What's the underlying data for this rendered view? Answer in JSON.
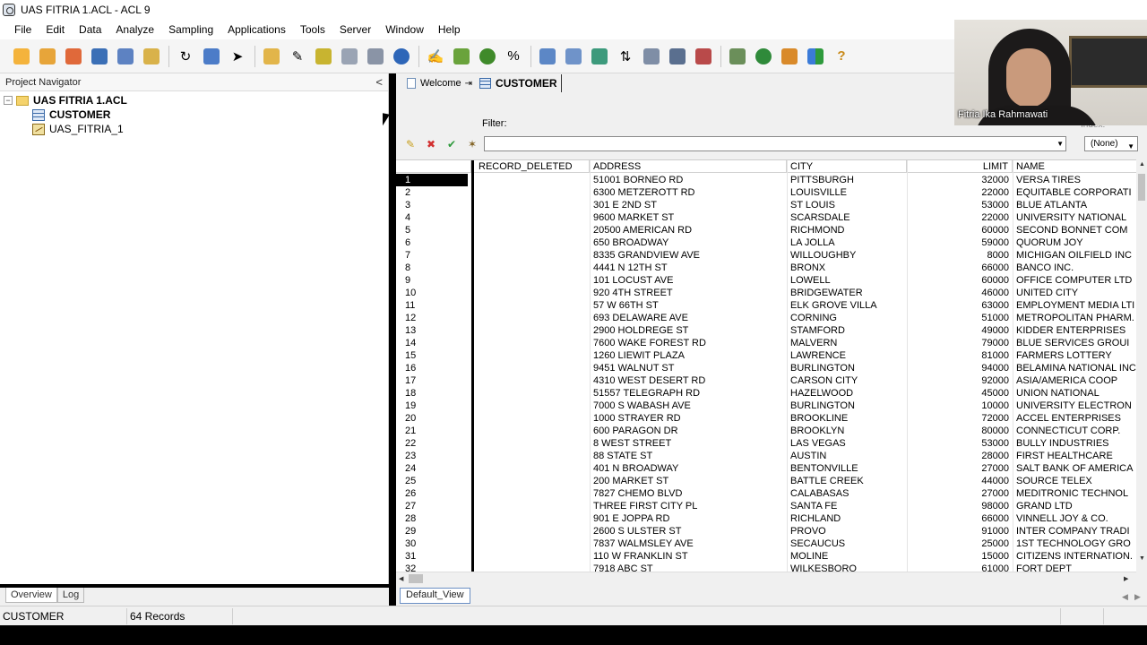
{
  "window": {
    "title": "UAS FITRIA 1.ACL - ACL 9"
  },
  "menu": [
    "File",
    "Edit",
    "Data",
    "Analyze",
    "Sampling",
    "Applications",
    "Tools",
    "Server",
    "Window",
    "Help"
  ],
  "navigator": {
    "title": "Project Navigator",
    "collapse_symbol": "<",
    "project": "UAS FITRIA 1.ACL",
    "items": [
      "CUSTOMER",
      "UAS_FITRIA_1"
    ],
    "tabs": [
      "Overview",
      "Log"
    ]
  },
  "doc_tabs": {
    "welcome": "Welcome",
    "customer": "CUSTOMER"
  },
  "filter": {
    "label": "Filter:",
    "value": "",
    "index_label": "Index:",
    "index_value": "(None)"
  },
  "table": {
    "columns": [
      "RECORD_DELETED",
      "ADDRESS",
      "CITY",
      "LIMIT",
      "NAME"
    ],
    "rows": [
      [
        "1",
        "",
        "51001 BORNEO RD",
        "PITTSBURGH",
        "32000",
        "VERSA TIRES"
      ],
      [
        "2",
        "",
        "6300 METZEROTT RD",
        "LOUISVILLE",
        "22000",
        "EQUITABLE CORPORATI"
      ],
      [
        "3",
        "",
        "301 E 2ND ST",
        "ST LOUIS",
        "53000",
        "BLUE ATLANTA"
      ],
      [
        "4",
        "",
        "9600 MARKET ST",
        "SCARSDALE",
        "22000",
        "UNIVERSITY NATIONAL"
      ],
      [
        "5",
        "",
        "20500 AMERICAN RD",
        "RICHMOND",
        "60000",
        "SECOND BONNET COM"
      ],
      [
        "6",
        "",
        "650 BROADWAY",
        "LA JOLLA",
        "59000",
        "QUORUM JOY"
      ],
      [
        "7",
        "",
        "8335 GRANDVIEW AVE",
        "WILLOUGHBY",
        "8000",
        "MICHIGAN OILFIELD INC"
      ],
      [
        "8",
        "",
        "4441 N 12TH ST",
        "BRONX",
        "66000",
        "BANCO INC."
      ],
      [
        "9",
        "",
        "101 LOCUST AVE",
        "LOWELL",
        "60000",
        "OFFICE COMPUTER LTD"
      ],
      [
        "10",
        "",
        "920 4TH STREET",
        "BRIDGEWATER",
        "46000",
        "UNITED CITY"
      ],
      [
        "11",
        "",
        "57 W 66TH ST",
        "ELK GROVE VILLA",
        "63000",
        "EMPLOYMENT MEDIA LTI"
      ],
      [
        "12",
        "",
        "693 DELAWARE AVE",
        "CORNING",
        "51000",
        "METROPOLITAN PHARM."
      ],
      [
        "13",
        "",
        "2900 HOLDREGE ST",
        "STAMFORD",
        "49000",
        "KIDDER ENTERPRISES"
      ],
      [
        "14",
        "",
        "7600 WAKE FOREST RD",
        "MALVERN",
        "79000",
        "BLUE SERVICES GROUI"
      ],
      [
        "15",
        "",
        "1260 LIEWIT PLAZA",
        "LAWRENCE",
        "81000",
        "FARMERS LOTTERY"
      ],
      [
        "16",
        "",
        "9451 WALNUT ST",
        "BURLINGTON",
        "94000",
        "BELAMINA NATIONAL INC"
      ],
      [
        "17",
        "",
        "4310 WEST DESERT RD",
        "CARSON CITY",
        "92000",
        "ASIA/AMERICA COOP"
      ],
      [
        "18",
        "",
        "51557 TELEGRAPH RD",
        "HAZELWOOD",
        "45000",
        "UNION NATIONAL"
      ],
      [
        "19",
        "",
        "7000 S WABASH AVE",
        "BURLINGTON",
        "10000",
        "UNIVERSITY ELECTRON"
      ],
      [
        "20",
        "",
        "1000 STRAYER RD",
        "BROOKLINE",
        "72000",
        "ACCEL ENTERPRISES"
      ],
      [
        "21",
        "",
        "600 PARAGON DR",
        "BROOKLYN",
        "80000",
        "CONNECTICUT CORP."
      ],
      [
        "22",
        "",
        "8 WEST STREET",
        "LAS VEGAS",
        "53000",
        "BULLY INDUSTRIES"
      ],
      [
        "23",
        "",
        "88 STATE ST",
        "AUSTIN",
        "28000",
        "FIRST HEALTHCARE"
      ],
      [
        "24",
        "",
        "401 N BROADWAY",
        "BENTONVILLE",
        "27000",
        "SALT BANK OF AMERICA"
      ],
      [
        "25",
        "",
        "200 MARKET ST",
        "BATTLE CREEK",
        "44000",
        "SOURCE TELEX"
      ],
      [
        "26",
        "",
        "7827 CHEMO BLVD",
        "CALABASAS",
        "27000",
        "MEDITRONIC TECHNOL"
      ],
      [
        "27",
        "",
        "THREE FIRST CITY PL",
        "SANTA FE",
        "98000",
        "GRAND LTD"
      ],
      [
        "28",
        "",
        "901 E JOPPA RD",
        "RICHLAND",
        "66000",
        "VINNELL JOY & CO."
      ],
      [
        "29",
        "",
        "2600 S ULSTER ST",
        "PROVO",
        "91000",
        "INTER COMPANY TRADI"
      ],
      [
        "30",
        "",
        "7837 WALMSLEY AVE",
        "SECAUCUS",
        "25000",
        "1ST TECHNOLOGY GRO"
      ],
      [
        "31",
        "",
        "110 W FRANKLIN ST",
        "MOLINE",
        "15000",
        "CITIZENS INTERNATION."
      ],
      [
        "32",
        "",
        "7918 ABC ST",
        "WILKESBORO",
        "61000",
        "FORT DEPT"
      ]
    ]
  },
  "view_tab": "Default_View",
  "status": {
    "table": "CUSTOMER",
    "records": "64 Records"
  },
  "webcam": {
    "name": "Fitria Ika Rahmawati"
  }
}
